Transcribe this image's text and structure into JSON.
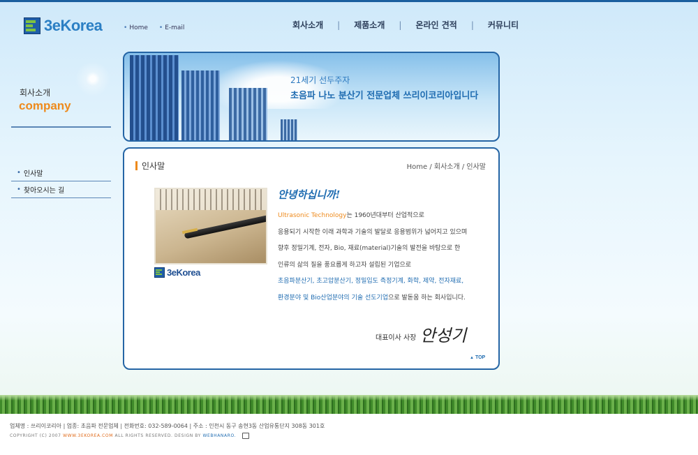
{
  "header": {
    "logo_text": "3eKorea",
    "util_links": [
      "Home",
      "E-mail"
    ],
    "nav": [
      "회사소개",
      "제품소개",
      "온라인 견적",
      "커뮤니티"
    ],
    "nav_separator": "|"
  },
  "sidebar": {
    "title_ko": "회사소개",
    "title_en": "company",
    "items": [
      {
        "label": "인사말"
      },
      {
        "label": "찾아오시는 길"
      }
    ]
  },
  "banner": {
    "subtitle": "21세기 선두주자",
    "title": "초음파 나노 분산기 전문업체 쓰리이코리아입니다"
  },
  "content": {
    "page_title": "인사말",
    "breadcrumb": "Home / 회사소개 / 인사말",
    "photo_logo": "3eKorea",
    "greeting": "안녕하십니까!",
    "message": {
      "l1_accent": "Ultrasonic Technology",
      "l1_rest": "는 1960년대부터 산업적으로",
      "l2": "응용되기 시작한 이래 과학과 기술의 발달로 응용범위가 넓어지고 있으며",
      "l3": "향후 정밀기계, 전자, Bio, 재료(material)기술의 발전을 바탕으로 한",
      "l4": "인류의 삶의 질을 풍요롭게 하고자 설립된 기업으로",
      "l5": "초음파분산기, 초고압분산기, 정밀입도 측정기계, 화학, 제약, 전자재료,",
      "l6_accent": "환경분야 및 Bio산업분야의 기술 선도기업",
      "l6_rest": "으로 발돋움 하는 회사입니다."
    },
    "signer_title": "대표이사 사장",
    "signer_name": "안성기",
    "top_link": "TOP"
  },
  "footer": {
    "info": "업체명 : 쓰리이코리아  |  업종: 초음파 전문업체  |  전화번호: 032-589-0064  |  주소 : 인천시 동구 송현3동 산업유통단지 308동 301호",
    "copyright_prefix": "COPYRIGHT (C) 2007",
    "copyright_site": "WWW.3EKOREA.COM",
    "copyright_mid": "ALL RIGHTS RESERVED. DESIGN BY",
    "copyright_designer": "WEBHANARO."
  },
  "colors": {
    "brand_blue": "#1f6cb1",
    "accent_orange": "#ee8a1c",
    "frame_blue": "#2565a5"
  }
}
